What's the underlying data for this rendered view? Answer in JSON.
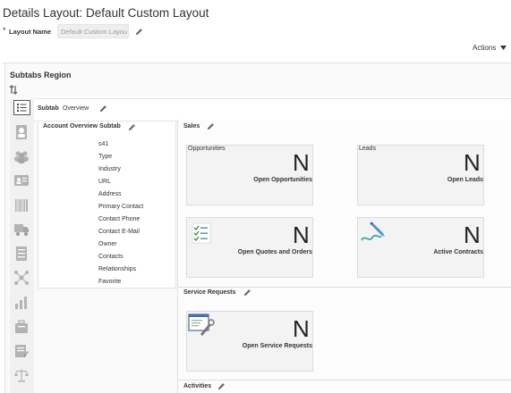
{
  "page_title": "Details Layout: Default Custom Layout",
  "layout_name": {
    "required_mark": "*",
    "label": "Layout Name",
    "value": "Default Custom Layou"
  },
  "actions_label": "Actions",
  "subtabs_region": {
    "title": "Subtabs Region",
    "subtab_label": "Subtab",
    "subtab_name": "Overview"
  },
  "left_icons": [
    "list-icon",
    "contact-icon",
    "people-icon",
    "card-icon",
    "barcode-icon",
    "truck-icon",
    "checklist-icon",
    "network-icon",
    "chart-icon",
    "briefcase-icon",
    "document-icon",
    "scale-icon"
  ],
  "account_overview": {
    "title": "Account Overview Subtab",
    "fields": [
      "s41",
      "Type",
      "Industry",
      "URL",
      "Address",
      "Primary Contact",
      "Contact Phone",
      "Contact E-Mail",
      "Owner",
      "Contacts",
      "Relationships",
      "Favorite"
    ]
  },
  "sales": {
    "title": "Sales",
    "tiles": [
      {
        "label": "Opportunities",
        "value": "N",
        "caption": "Open Opportunities"
      },
      {
        "label": "Leads",
        "value": "N",
        "caption": "Open Leads"
      },
      {
        "label": "",
        "value": "N",
        "caption": "Open Quotes and Orders"
      },
      {
        "label": "",
        "value": "N",
        "caption": "Active Contracts"
      }
    ]
  },
  "service_requests": {
    "title": "Service Requests",
    "tile": {
      "value": "N",
      "caption": "Open Service Requests"
    }
  },
  "activities": {
    "title": "Activities"
  }
}
